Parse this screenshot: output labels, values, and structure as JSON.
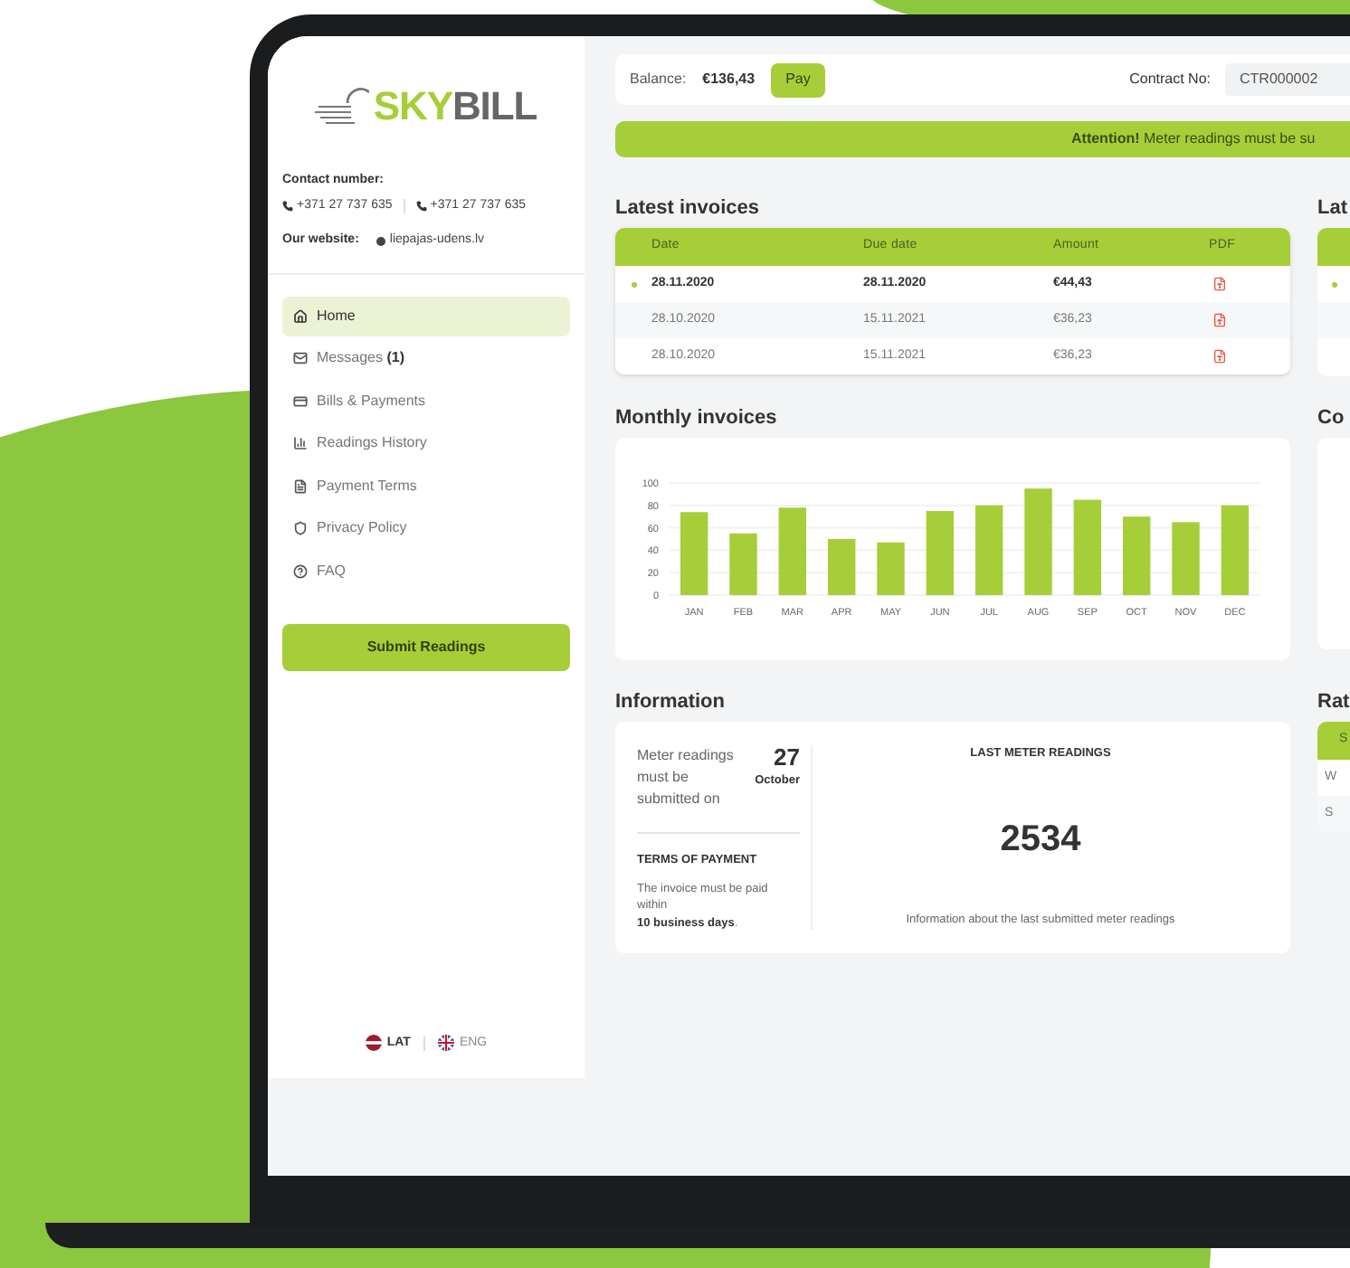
{
  "sidebar": {
    "logo": {
      "first": "SKY",
      "second": "BILL"
    },
    "contact_label": "Contact number:",
    "phones": [
      "+371 27 737 635",
      "+371 27 737 635"
    ],
    "website_label": "Our website:",
    "website": "liepajas-udens.lv",
    "nav": [
      {
        "kind": "home",
        "label": "Home",
        "selected": true
      },
      {
        "kind": "messages",
        "label": "Messages",
        "count": "(1)",
        "selected": false
      },
      {
        "kind": "bills",
        "label": "Bills & Payments",
        "selected": false
      },
      {
        "kind": "history",
        "label": "Readings History",
        "selected": false
      },
      {
        "kind": "terms",
        "label": "Payment Terms",
        "selected": false
      },
      {
        "kind": "privacy",
        "label": "Privacy Policy",
        "selected": false
      },
      {
        "kind": "faq",
        "label": "FAQ",
        "selected": false
      }
    ],
    "submit_button": "Submit Readings",
    "languages": [
      {
        "kind": "lv",
        "code": "LAT",
        "selected": true
      },
      {
        "kind": "gb",
        "code": "ENG",
        "selected": false
      }
    ]
  },
  "top_bar": {
    "balance_label": "Balance:",
    "balance": "€136,43",
    "pay_button": "Pay",
    "contract_label": "Contract No:",
    "contract_value": "CTR000002"
  },
  "attention": "**Attention!** Meter readings must be su",
  "latest_invoices": {
    "title": "Latest invoices",
    "columns": [
      "Date",
      "Due date",
      "Amount",
      "PDF"
    ],
    "rows": [
      {
        "date": "28.11.2020",
        "due": "28.11.2020",
        "amount": "€44,43",
        "unread": true
      },
      {
        "date": "28.10.2020",
        "due": "15.11.2021",
        "amount": "€36,23",
        "unread": false
      },
      {
        "date": "28.10.2020",
        "due": "15.11.2021",
        "amount": "€36,23",
        "unread": false
      }
    ]
  },
  "monthly_invoices": {
    "title": "Monthly invoices",
    "chart_data": {
      "type": "bar",
      "categories": [
        "JAN",
        "FEB",
        "MAR",
        "APR",
        "MAY",
        "JUN",
        "JUL",
        "AUG",
        "SEP",
        "OCT",
        "NOV",
        "DEC"
      ],
      "series": [
        {
          "color": "#a6ce39",
          "values": [
            74,
            55,
            78,
            50,
            47,
            75,
            80,
            95,
            85,
            70,
            65,
            80
          ]
        }
      ],
      "ylim": [
        0,
        100
      ],
      "yticks": [
        0,
        20,
        40,
        60,
        80,
        100
      ],
      "grid": true
    }
  },
  "information": {
    "title": "Information",
    "deadline_text": "Meter readings must be submitted on",
    "deadline_day": "27",
    "deadline_month": "October",
    "terms_title": "TERMS OF PAYMENT",
    "terms_text": "The invoice must be paid within\n**10 business days**.",
    "last_title": "LAST METER READINGS",
    "last_value": "2534",
    "last_caption": "Information about the last submitted meter readings"
  },
  "right_column": {
    "latest_heading": "Lat",
    "latest_unread": true,
    "contract_heading": "Co",
    "rates_heading": "Rat",
    "rates_header": "S",
    "rates_rows": [
      "W",
      "S"
    ]
  }
}
